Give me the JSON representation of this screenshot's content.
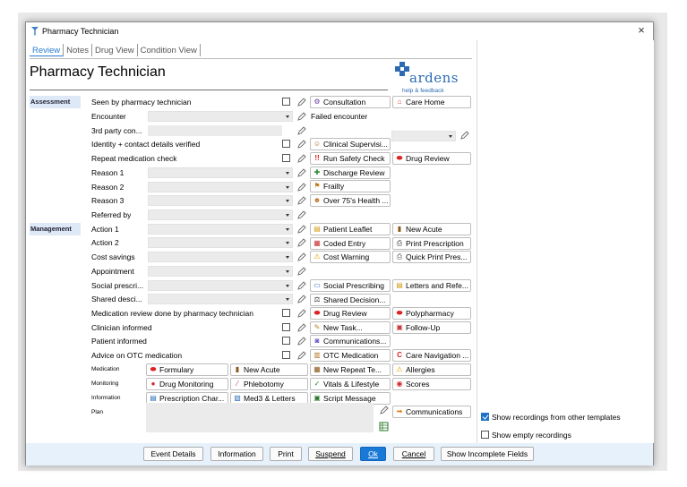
{
  "window": {
    "title": "Pharmacy Technician",
    "close_label": "×"
  },
  "tabs": [
    "Review",
    "Notes",
    "Drug View",
    "Condition View"
  ],
  "page_title": "Pharmacy Technician",
  "logo": {
    "word": "ardens",
    "help": "help & feedback"
  },
  "sections": {
    "assessment": "Assessment",
    "management": "Management"
  },
  "rows": [
    {
      "label": "Seen by pharmacy technician",
      "control": "checkbox"
    },
    {
      "label": "Encounter",
      "control": "dropdown"
    },
    {
      "label": "3rd party con...",
      "control": "textbox"
    },
    {
      "label": "Identity + contact details verified",
      "control": "checkbox"
    },
    {
      "label": "Repeat medication check",
      "control": "checkbox"
    },
    {
      "label": "Reason 1",
      "control": "dropdown"
    },
    {
      "label": "Reason 2",
      "control": "dropdown"
    },
    {
      "label": "Reason 3",
      "control": "dropdown"
    },
    {
      "label": "Referred by",
      "control": "dropdown"
    },
    {
      "label": "Action 1",
      "control": "dropdown"
    },
    {
      "label": "Action 2",
      "control": "dropdown"
    },
    {
      "label": "Cost savings",
      "control": "dropdown"
    },
    {
      "label": "Appointment",
      "control": "dropdown"
    },
    {
      "label": "Social prescri...",
      "control": "dropdown"
    },
    {
      "label": "Shared desci...",
      "control": "dropdown"
    },
    {
      "label": "Medication review done by pharmacy technician",
      "control": "checkbox"
    },
    {
      "label": "Clinician informed",
      "control": "checkbox"
    },
    {
      "label": "Patient informed",
      "control": "checkbox"
    },
    {
      "label": "Advice on OTC medication",
      "control": "checkbox"
    }
  ],
  "failed_encounter": "Failed encounter",
  "small_labels": {
    "medication": "Medication",
    "monitoring": "Monitoring",
    "information": "Information",
    "plan": "Plan"
  },
  "buttons": {
    "consultation": "Consultation",
    "care_home": "Care Home",
    "clinical_supervision": "Clinical Supervisi...",
    "run_safety_check": "Run Safety Check",
    "drug_review_1": "Drug Review",
    "discharge_review": "Discharge Review",
    "frailty": "Frailty",
    "over75": "Over 75's Health ...",
    "patient_leaflet": "Patient Leaflet",
    "new_acute_1": "New Acute",
    "coded_entry": "Coded Entry",
    "print_prescription": "Print Prescription",
    "cost_warning": "Cost Warning",
    "quick_print": "Quick Print Pres...",
    "social_prescribing": "Social Prescribing",
    "letters": "Letters and Refe...",
    "shared_decision": "Shared Decision...",
    "drug_review_2": "Drug Review",
    "polypharmacy": "Polypharmacy",
    "new_task": "New Task...",
    "follow_up": "Follow-Up",
    "communications_1": "Communications...",
    "otc_medication": "OTC Medication",
    "care_navigation": "Care Navigation ...",
    "formulary": "Formulary",
    "new_acute_2": "New Acute",
    "new_repeat": "New Repeat Te...",
    "allergies": "Allergies",
    "drug_monitoring": "Drug Monitoring",
    "phlebotomy": "Phlebotomy",
    "vitals": "Vitals & Lifestyle",
    "scores": "Scores",
    "prescription_chart": "Prescription Char...",
    "med3": "Med3 & Letters",
    "script_message": "Script Message",
    "communications_2": "Communications"
  },
  "options": {
    "show_other": {
      "label": "Show recordings from other templates",
      "checked": true
    },
    "show_empty": {
      "label": "Show empty recordings",
      "checked": false
    }
  },
  "footer": {
    "event_details": "Event Details",
    "information": "Information",
    "print": "Print",
    "suspend": "Suspend",
    "ok": "Ok",
    "cancel": "Cancel",
    "show_incomplete": "Show Incomplete Fields"
  },
  "colors": {
    "accent": "#1979d6",
    "section_bg": "#dde9f6",
    "footer_bg": "#e6f1fb",
    "logo": "#2c6bb3"
  }
}
